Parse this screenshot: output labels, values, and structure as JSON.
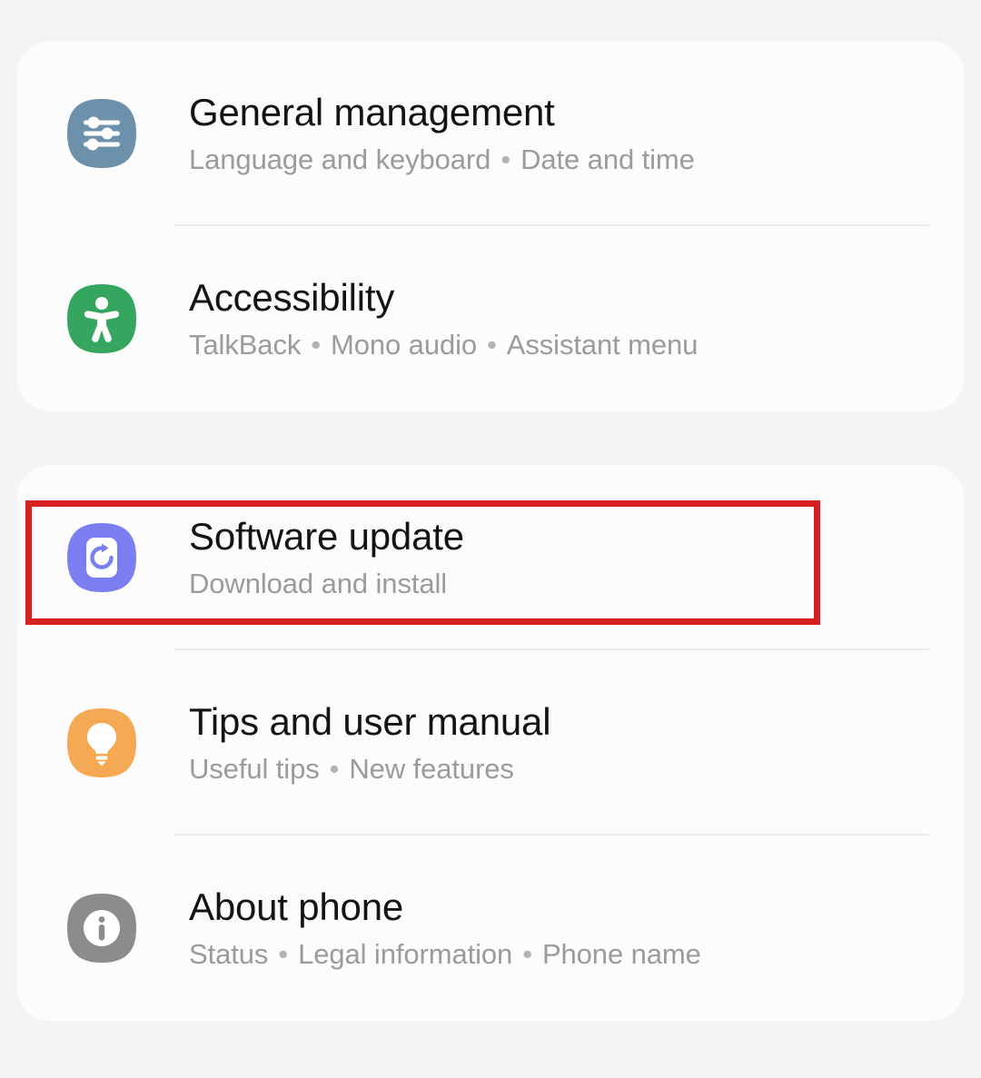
{
  "screen": {
    "name": "settings-screen",
    "background_color": "#f4f4f4",
    "card_background_color": "#fcfcfc",
    "title_color": "#141414",
    "subtitle_color": "#9b9b9b",
    "divider_color": "#eaeaea"
  },
  "annotation": {
    "name": "software-update-highlight",
    "color": "#d82020",
    "border_width": "7px",
    "targets": "Software update"
  },
  "cards": [
    {
      "id": "card-one",
      "rows": [
        {
          "title": "General management",
          "subtitle_parts": [
            "Language and keyboard",
            "Date and time"
          ],
          "icon": "sliders-icon",
          "icon_color": "#6d90ab",
          "icon_glyph_color": "#ffffff",
          "has_divider": true
        },
        {
          "title": "Accessibility",
          "subtitle_parts": [
            "TalkBack",
            "Mono audio",
            "Assistant menu"
          ],
          "icon": "accessibility-person-icon",
          "icon_color": "#35a65f",
          "icon_glyph_color": "#ffffff",
          "has_divider": false
        }
      ]
    },
    {
      "id": "card-two",
      "rows": [
        {
          "title": "Software update",
          "subtitle_parts": [
            "Download and install"
          ],
          "icon": "software-update-refresh-icon",
          "icon_color": "#7b7ef0",
          "icon_glyph_color": "#ffffff",
          "has_divider": true
        },
        {
          "title": "Tips and user manual",
          "subtitle_parts": [
            "Useful tips",
            "New features"
          ],
          "icon": "lightbulb-icon",
          "icon_color": "#f6a953",
          "icon_glyph_color": "#ffffff",
          "has_divider": true
        },
        {
          "title": "About phone",
          "subtitle_parts": [
            "Status",
            "Legal information",
            "Phone name"
          ],
          "icon": "info-circle-icon",
          "icon_color": "#8c8c8c",
          "icon_glyph_color": "#ffffff",
          "has_divider": false
        }
      ]
    }
  ],
  "separator_glyph": "•"
}
